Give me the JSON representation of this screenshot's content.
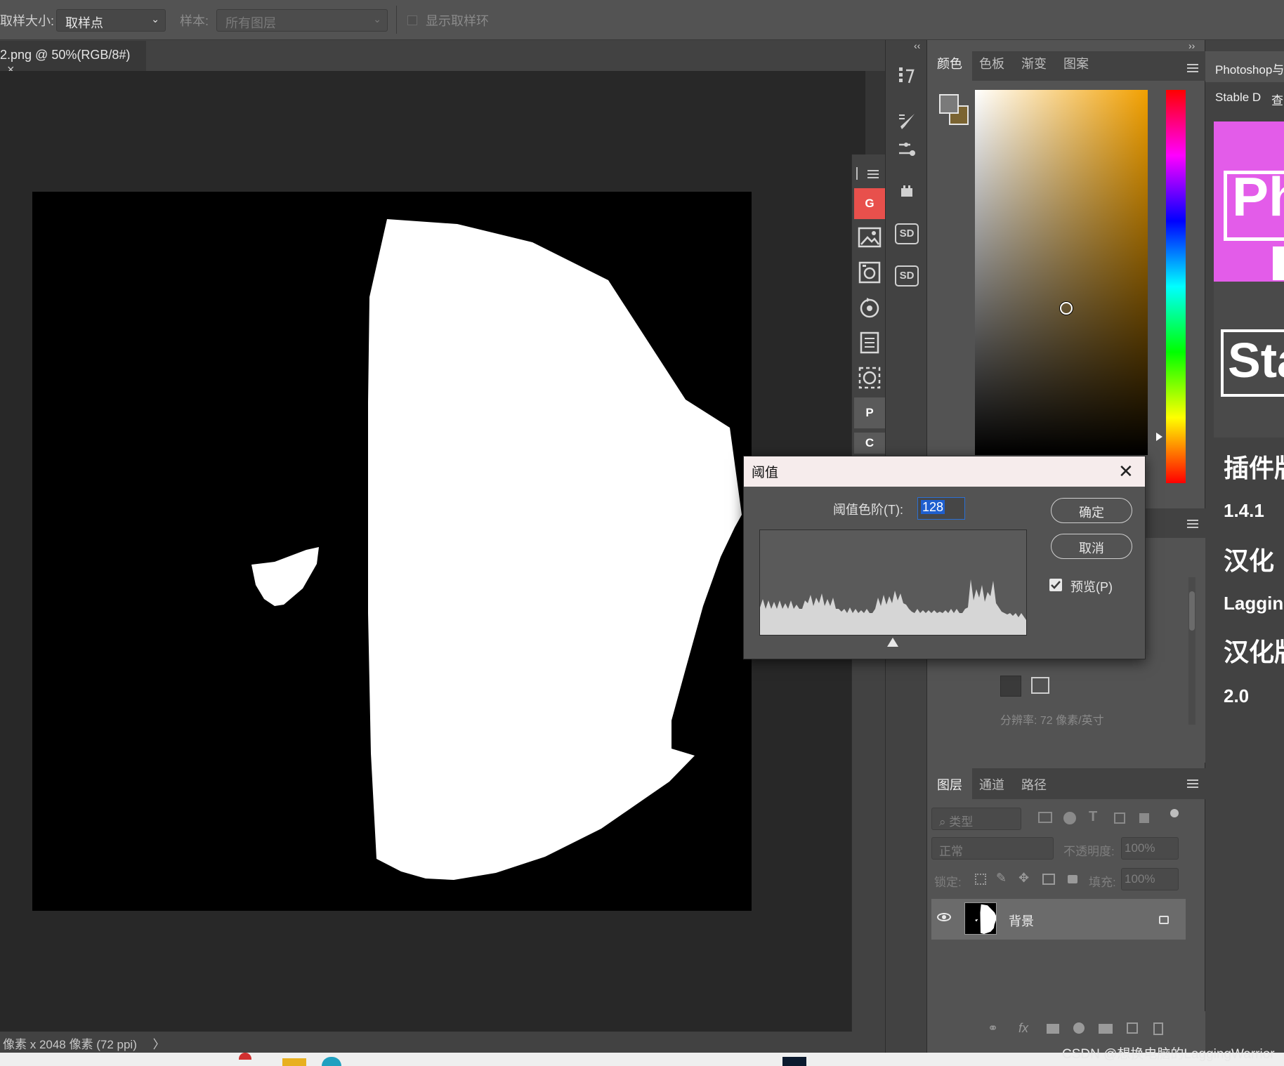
{
  "options_bar": {
    "sample_size_label": "取样大小:",
    "sample_size_value": "取样点",
    "sample_label": "样本:",
    "sample_value": "所有图层",
    "show_ring_label": "显示取样环"
  },
  "document": {
    "tab_title": "2.png @ 50%(RGB/8#)",
    "tab_close": "×",
    "status": "像素 x 2048 像素 (72 ppi)",
    "status_arrow": "〉"
  },
  "plugin_strip": {
    "items": [
      "G",
      "P",
      "C"
    ]
  },
  "tool_column": {
    "collapse_left": "‹‹",
    "sd1": "SD",
    "sd2": "SD"
  },
  "color_panel": {
    "collapse_right": "››",
    "tabs": [
      "颜色",
      "色板",
      "渐变",
      "图案"
    ],
    "active_tab": "颜色",
    "foreground_color": "#7a7a7a",
    "background_color": "#7b6432"
  },
  "properties": {
    "resolution": "分辨率: 72 像素/英寸"
  },
  "layers_panel": {
    "tabs": [
      "图层",
      "通道",
      "路径"
    ],
    "filter_placeholder": "类型",
    "blend_mode": "正常",
    "opacity_label": "不透明度:",
    "opacity_value": "100%",
    "lock_label": "锁定:",
    "fill_label": "填充:",
    "fill_value": "100%",
    "layer_name": "背景"
  },
  "right_panel": {
    "title": "Photoshop与",
    "sub_tab1": "Stable D",
    "sub_tab2": "查",
    "promo_line1": "Ph",
    "promo_line2": "Sta",
    "lines": [
      "插件版",
      "1.4.1",
      "汉化",
      "Lagging",
      "汉化版",
      "2.0"
    ]
  },
  "threshold_dialog": {
    "title": "阈值",
    "level_label": "阈值色阶(T):",
    "level_value": "128",
    "ok_label": "确定",
    "cancel_label": "取消",
    "preview_label": "预览(P)",
    "preview_checked": true
  },
  "watermark": "CSDN @想换电脑的LaggingWarrior"
}
